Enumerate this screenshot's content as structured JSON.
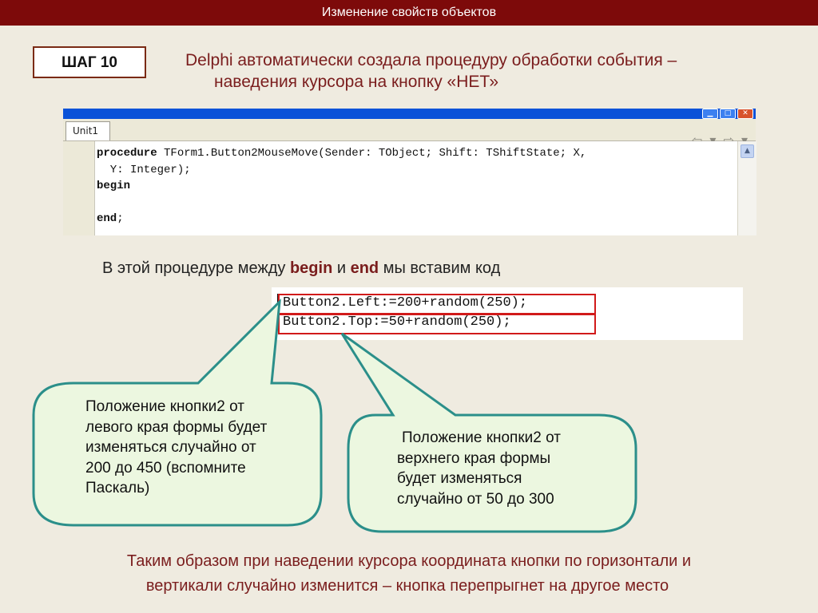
{
  "header": {
    "title": "Изменение свойств объектов"
  },
  "step": {
    "label": "ШАГ 10"
  },
  "intro": {
    "line1": "Delphi автоматически создала процедуру обработки события –",
    "line2": "наведения курсора на кнопку «НЕТ»"
  },
  "editor": {
    "tab_label": "Unit1",
    "nav_arrows": "⇦ ▾ ⇨ ▾",
    "code_lines": [
      {
        "kw": "procedure",
        "rest": " TForm1.Button2MouseMove(Sender: TObject; Shift: TShiftState; X,"
      },
      {
        "kw": "",
        "rest": "  Y: Integer);"
      },
      {
        "kw": "begin",
        "rest": ""
      },
      {
        "kw": "",
        "rest": ""
      },
      {
        "kw": "end",
        "rest": ";"
      }
    ]
  },
  "middle": {
    "prefix": "В этой процедуре между ",
    "begin": "begin",
    "and": " и ",
    "end": "end",
    "suffix": " мы вставим код"
  },
  "snippet": {
    "line1": "Button2.Left:=200+random(250);",
    "line2": "Button2.Top:=50+random(250);"
  },
  "callouts": {
    "left": [
      "Положение кнопки2 от",
      "левого края формы будет",
      "изменяться случайно от",
      "200 до 450 (вспомните",
      "Паскаль)"
    ],
    "right": [
      "Положение кнопки2 от",
      "верхнего края формы",
      "будет изменяться",
      "случайно от 50 до 300"
    ]
  },
  "conclusion": {
    "line1": "Таким образом при наведении курсора координата кнопки по горизонтали и",
    "line2": "вертикали случайно изменится – кнопка перепрыгнет на другое место"
  },
  "colors": {
    "header_bg": "#7d0a0a",
    "accent_text": "#7a1d1d",
    "callout_fill": "#ecf7e0",
    "callout_border": "#2b8f8a",
    "highlight": "#d11a1a"
  }
}
